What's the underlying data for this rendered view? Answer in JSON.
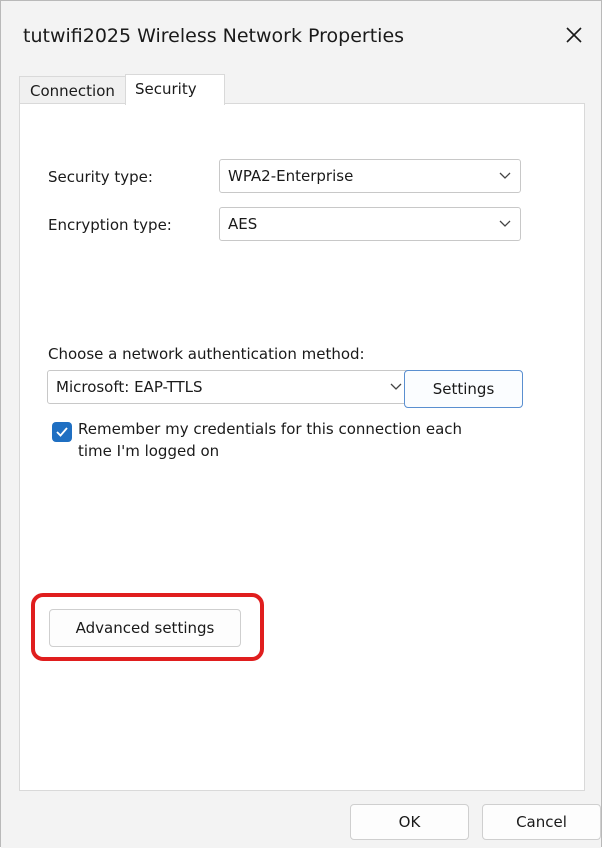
{
  "window": {
    "title": "tutwifi2025 Wireless Network Properties"
  },
  "tabs": [
    {
      "label": "Connection"
    },
    {
      "label": "Security"
    }
  ],
  "security": {
    "security_type_label": "Security type:",
    "security_type_value": "WPA2-Enterprise",
    "encryption_type_label": "Encryption type:",
    "encryption_type_value": "AES",
    "auth_method_label": "Choose a network authentication method:",
    "auth_method_value": "Microsoft: EAP-TTLS",
    "settings_button": "Settings",
    "remember_line1": "Remember my credentials for this connection each",
    "remember_line2": "time I'm logged on",
    "remember_checked": true,
    "advanced_button": "Advanced settings"
  },
  "footer": {
    "ok_label": "OK",
    "cancel_label": "Cancel"
  },
  "colors": {
    "accent": "#1f6fc2",
    "highlight": "#e01e1e"
  }
}
